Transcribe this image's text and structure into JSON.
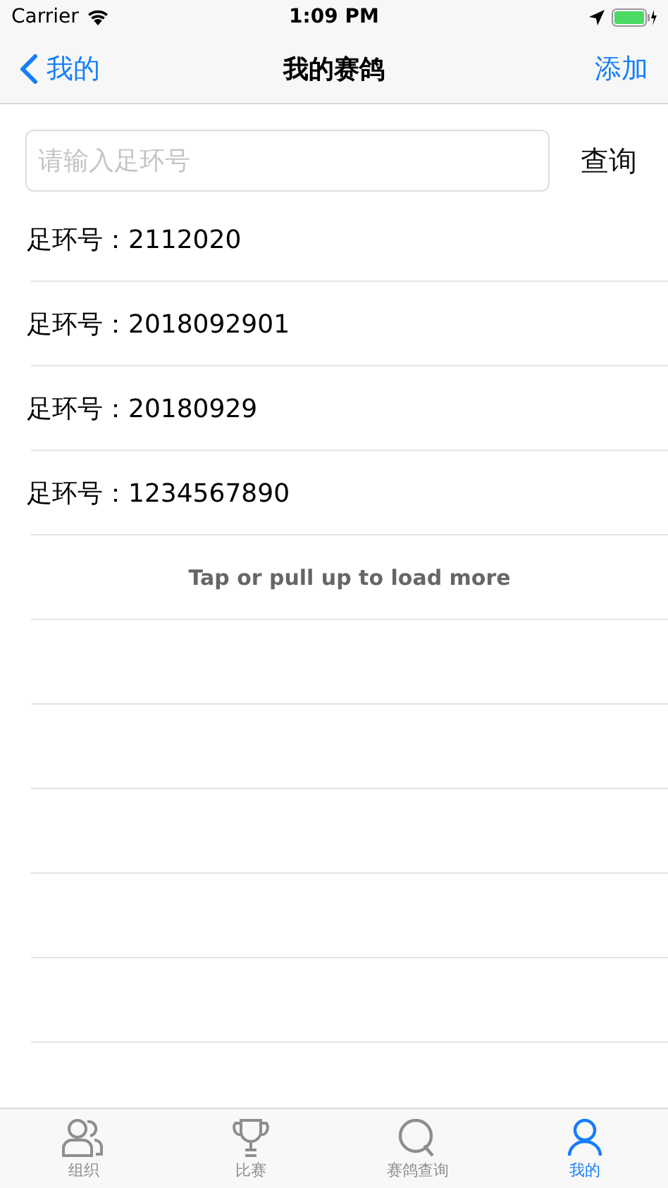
{
  "status_bar": {
    "carrier": "Carrier",
    "time": "1:09 PM"
  },
  "nav": {
    "back": "我的",
    "title": "我的赛鸽",
    "action": "添加"
  },
  "search": {
    "placeholder": "请输入足环号",
    "button": "查询"
  },
  "rows": [
    {
      "label": "足环号：",
      "value": "2112020"
    },
    {
      "label": "足环号：",
      "value": "2018092901"
    },
    {
      "label": "足环号：",
      "value": "20180929"
    },
    {
      "label": "足环号：",
      "value": "1234567890"
    }
  ],
  "load_more": "Tap or pull up to load more",
  "tabs": [
    {
      "label": "组织",
      "selected": false
    },
    {
      "label": "比赛",
      "selected": false
    },
    {
      "label": "赛鸽查询",
      "selected": false
    },
    {
      "label": "我的",
      "selected": true
    }
  ]
}
